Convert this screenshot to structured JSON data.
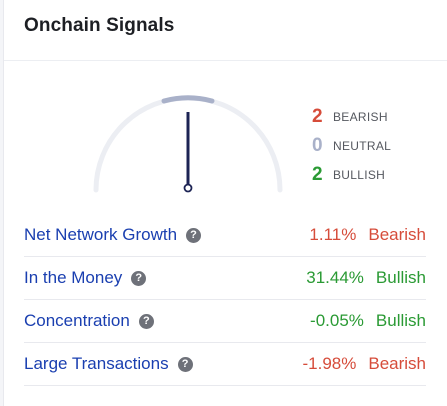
{
  "card": {
    "title": "Onchain Signals"
  },
  "colors": {
    "bearish": "#d64c3a",
    "neutral": "#a9b1c9",
    "bullish": "#2a9a34",
    "link": "#1a3fb0"
  },
  "gauge": {
    "needle_icon": "gauge-needle-icon"
  },
  "counts": [
    {
      "value": "2",
      "label": "BEARISH",
      "color": "#d64c3a"
    },
    {
      "value": "0",
      "label": "NEUTRAL",
      "color": "#a9b1c9"
    },
    {
      "value": "2",
      "label": "BULLISH",
      "color": "#2a9a34"
    }
  ],
  "signals": [
    {
      "name": "Net Network Growth",
      "value": "1.11%",
      "verdict": "Bearish",
      "color": "#d64c3a"
    },
    {
      "name": "In the Money",
      "value": "31.44%",
      "verdict": "Bullish",
      "color": "#2a9a34"
    },
    {
      "name": "Concentration",
      "value": "-0.05%",
      "verdict": "Bullish",
      "color": "#2a9a34"
    },
    {
      "name": "Large Transactions",
      "value": "-1.98%",
      "verdict": "Bearish",
      "color": "#d64c3a"
    }
  ],
  "help_glyph": "?"
}
